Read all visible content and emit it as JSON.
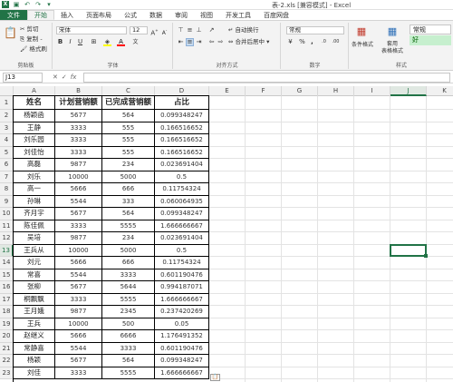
{
  "window": {
    "title": "表-2.xls [兼容模式] - Excel"
  },
  "qat": {
    "icons": [
      "excel-logo-icon",
      "save-icon",
      "undo-icon",
      "redo-icon",
      "customize-icon"
    ]
  },
  "tabs": [
    {
      "label": "文件",
      "active": false,
      "file": true
    },
    {
      "label": "开始",
      "active": true,
      "file": false
    },
    {
      "label": "插入",
      "active": false,
      "file": false
    },
    {
      "label": "页面布局",
      "active": false,
      "file": false
    },
    {
      "label": "公式",
      "active": false,
      "file": false
    },
    {
      "label": "数据",
      "active": false,
      "file": false
    },
    {
      "label": "审阅",
      "active": false,
      "file": false
    },
    {
      "label": "视图",
      "active": false,
      "file": false
    },
    {
      "label": "开发工具",
      "active": false,
      "file": false
    },
    {
      "label": "百度网盘",
      "active": false,
      "file": false
    }
  ],
  "ribbon": {
    "clipboard": {
      "cut": "剪切",
      "copy": "复制 -",
      "format_painter": "格式刷",
      "group": "剪贴板"
    },
    "font": {
      "name": "宋体",
      "size": "12",
      "group": "字体"
    },
    "alignment": {
      "wrap": "自动换行",
      "merge": "合并后居中",
      "group": "对齐方式"
    },
    "number": {
      "format": "常规",
      "group": "数字"
    },
    "styles": {
      "conditional": "条件格式",
      "table_format": "套用\n表格格式",
      "style_normal": "常规",
      "style_good": "好",
      "group": "样式"
    }
  },
  "formula_bar": {
    "name_box": "J13",
    "fx": "fx",
    "formula": ""
  },
  "columns": [
    "A",
    "B",
    "C",
    "D",
    "E",
    "F",
    "G",
    "H",
    "I",
    "J",
    "K"
  ],
  "selected_column": "J",
  "selected_row": 13,
  "table": {
    "headers": [
      "姓名",
      "计划营销额",
      "已完成营销额",
      "占比"
    ],
    "rows": [
      [
        "杨颖函",
        "5677",
        "564",
        "0.099348247"
      ],
      [
        "王静",
        "3333",
        "555",
        "0.166516652"
      ],
      [
        "刘乐园",
        "3333",
        "555",
        "0.166516652"
      ],
      [
        "刘佳怡",
        "3333",
        "555",
        "0.166516652"
      ],
      [
        "高磊",
        "9877",
        "234",
        "0.023691404"
      ],
      [
        "刘乐",
        "10000",
        "5000",
        "0.5"
      ],
      [
        "高一",
        "5666",
        "666",
        "0.11754324"
      ],
      [
        "孙琳",
        "5544",
        "333",
        "0.060064935"
      ],
      [
        "齐月宇",
        "5677",
        "564",
        "0.099348247"
      ],
      [
        "陈佳佩",
        "3333",
        "5555",
        "1.666666667"
      ],
      [
        "吴培",
        "9877",
        "234",
        "0.023691404"
      ],
      [
        "王兵从",
        "10000",
        "5000",
        "0.5"
      ],
      [
        "刘元",
        "5666",
        "666",
        "0.11754324"
      ],
      [
        "常喜",
        "5544",
        "3333",
        "0.601190476"
      ],
      [
        "张柳",
        "5677",
        "5644",
        "0.994187071"
      ],
      [
        "桐飘飘",
        "3333",
        "5555",
        "1.666666667"
      ],
      [
        "王月娥",
        "9877",
        "2345",
        "0.237420269"
      ],
      [
        "王兵",
        "10000",
        "500",
        "0.05"
      ],
      [
        "赵继义",
        "5666",
        "6666",
        "1.176491352"
      ],
      [
        "常静喜",
        "5544",
        "3333",
        "0.601190476"
      ],
      [
        "杨颖",
        "5677",
        "564",
        "0.099348247"
      ],
      [
        "刘佳",
        "3333",
        "5555",
        "1.666666667"
      ]
    ]
  }
}
